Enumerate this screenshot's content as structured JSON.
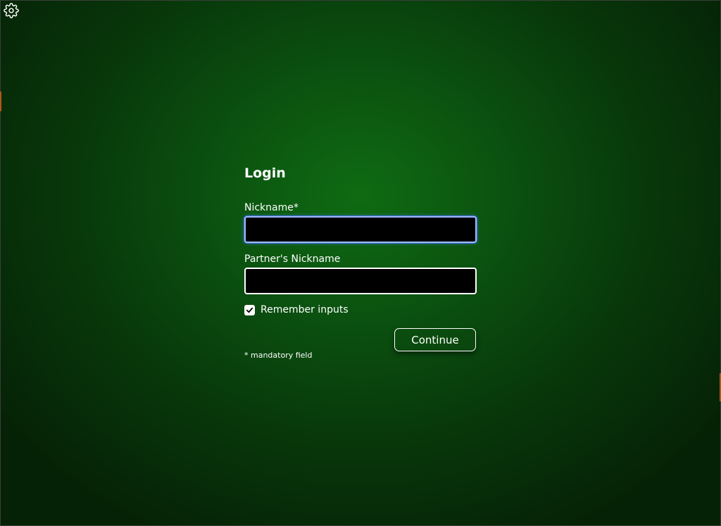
{
  "settings": {
    "icon": "gear-icon"
  },
  "login": {
    "title": "Login",
    "nickname_label": "Nickname*",
    "nickname_value": "",
    "partner_label": "Partner's Nickname",
    "partner_value": "",
    "remember_label": "Remember inputs",
    "remember_checked": true,
    "continue_label": "Continue",
    "mandatory_note": "* mandatory field"
  },
  "colors": {
    "background_center": "#0f6b12",
    "background_edge": "#062206",
    "input_background": "#000000",
    "focus_ring": "#3d6fe0",
    "text": "#ffffff"
  }
}
